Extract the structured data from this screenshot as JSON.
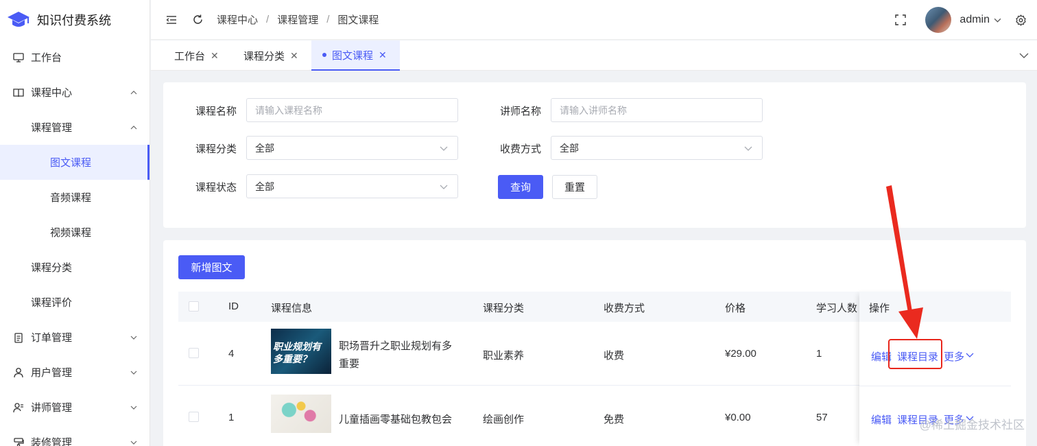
{
  "app": {
    "title": "知识付费系统"
  },
  "sidebar": {
    "items": [
      {
        "label": "工作台"
      },
      {
        "label": "课程中心"
      },
      {
        "label": "课程管理"
      },
      {
        "label": "图文课程"
      },
      {
        "label": "音频课程"
      },
      {
        "label": "视频课程"
      },
      {
        "label": "课程分类"
      },
      {
        "label": "课程评价"
      },
      {
        "label": "订单管理"
      },
      {
        "label": "用户管理"
      },
      {
        "label": "讲师管理"
      },
      {
        "label": "装修管理"
      }
    ]
  },
  "header": {
    "breadcrumb": [
      "课程中心",
      "课程管理",
      "图文课程"
    ],
    "separator": "/",
    "user": "admin"
  },
  "tabs": [
    {
      "label": "工作台"
    },
    {
      "label": "课程分类"
    },
    {
      "label": "图文课程"
    }
  ],
  "tab_close": "✕",
  "filters": {
    "course_name_label": "课程名称",
    "course_name_placeholder": "请输入课程名称",
    "teacher_name_label": "讲师名称",
    "teacher_name_placeholder": "请输入讲师名称",
    "category_label": "课程分类",
    "category_value": "全部",
    "fee_label": "收费方式",
    "fee_value": "全部",
    "status_label": "课程状态",
    "status_value": "全部",
    "search_button": "查询",
    "reset_button": "重置"
  },
  "add_button": "新增图文",
  "table": {
    "columns": [
      "ID",
      "课程信息",
      "课程分类",
      "收费方式",
      "价格",
      "学习人数",
      "操作"
    ],
    "rows": [
      {
        "id": "4",
        "title_line1": "职场晋升之职业规划有多",
        "title_line2": "重要",
        "thumb_text_1": "职业规划有",
        "thumb_text_2": "多重要？",
        "category": "职业素养",
        "fee": "收费",
        "price": "¥29.00",
        "learners": "1"
      },
      {
        "id": "1",
        "title_line1": "儿童插画零基础包教包会",
        "category": "绘画创作",
        "fee": "免费",
        "price": "¥0.00",
        "learners": "57"
      }
    ],
    "actions": {
      "edit": "编辑",
      "catalog": "课程目录",
      "more": "更多"
    }
  },
  "watermark": "@稀土掘金技术社区",
  "colors": {
    "primary": "#4a5bf5",
    "highlight": "#e8271c"
  }
}
